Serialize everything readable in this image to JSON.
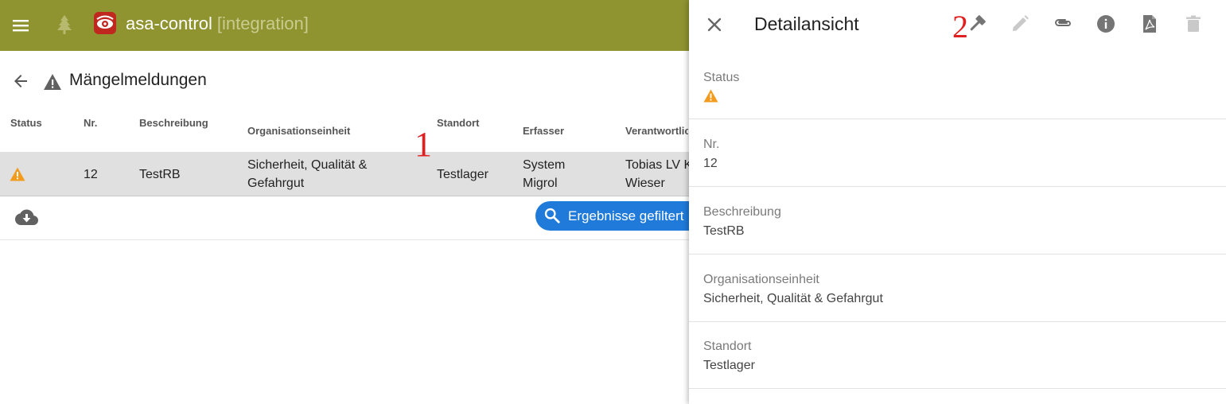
{
  "app": {
    "name": "asa-control",
    "environment": "[integration]"
  },
  "page": {
    "title": "Mängelmeldungen"
  },
  "table": {
    "columns": [
      "Status",
      "Nr.",
      "Beschreibung",
      "Organisationseinheit",
      "Standort",
      "Erfasser",
      "Verantwortlich"
    ],
    "row": {
      "status_icon": "warning-icon",
      "nr": "12",
      "beschreibung": "TestRB",
      "organisationseinheit_line1": "Sicherheit, Qualität &",
      "organisationseinheit_line2": "Gefahrgut",
      "standort": "Testlager",
      "erfasser_line1": "System",
      "erfasser_line2": "Migrol",
      "verantwortlich_line1": "Tobias LV K",
      "verantwortlich_line2": "Wieser"
    }
  },
  "filter_button": {
    "label": "Ergebnisse gefiltert"
  },
  "annotations": {
    "one": "1",
    "two": "2"
  },
  "detail": {
    "title": "Detailansicht",
    "toolbar_icons": [
      "hammer-icon",
      "edit-icon",
      "paperclip-icon",
      "info-icon",
      "pdf-icon",
      "delete-icon"
    ],
    "fields": {
      "status_label": "Status",
      "nr_label": "Nr.",
      "nr_value": "12",
      "beschreibung_label": "Beschreibung",
      "beschreibung_value": "TestRB",
      "org_label": "Organisationseinheit",
      "org_value": "Sicherheit, Qualität & Gefahrgut",
      "standort_label": "Standort",
      "standort_value": "Testlager"
    }
  },
  "colors": {
    "appbar": "#8f9431",
    "accent_blue": "#1f7ad9",
    "warning": "#f29b1d",
    "annotation_red": "#e02020"
  }
}
